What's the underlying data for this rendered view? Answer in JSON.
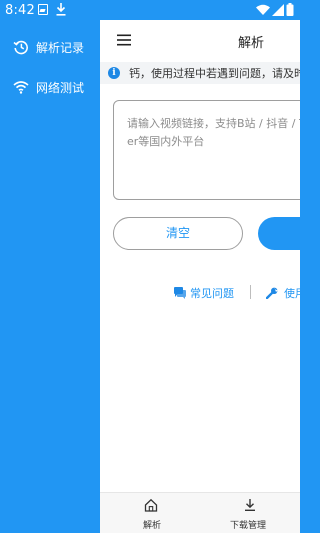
{
  "status_bar": {
    "time": "8:42",
    "left_icons": [
      "app-notification-icon",
      "download-icon"
    ],
    "right_icons": [
      "wifi-icon",
      "signal-icon",
      "battery-icon"
    ]
  },
  "drawer": {
    "items": [
      {
        "label": "解析记录",
        "icon": "history-icon"
      },
      {
        "label": "网络测试",
        "icon": "wifi-icon"
      }
    ]
  },
  "app_bar": {
    "title": "解析",
    "menu_icon": "menu-icon"
  },
  "notice": {
    "icon": "info-icon",
    "text": "钙，使用过程中若遇到问题，请及时反馈"
  },
  "url_input": {
    "placeholder": "请输入视频链接，支持B站 / 抖音 / Twitter等国内外平台",
    "value": ""
  },
  "buttons": {
    "clear": "清空",
    "parse": ""
  },
  "links": {
    "faq": "常见问题",
    "help": "使用"
  },
  "bottom_nav": [
    {
      "label": "解析",
      "icon": "home-icon"
    },
    {
      "label": "下载管理",
      "icon": "download-icon"
    }
  ],
  "colors": {
    "primary": "#2196F3",
    "notice_bg": "#F2F4F6",
    "text": "#222222",
    "placeholder": "#8C8C8C"
  }
}
